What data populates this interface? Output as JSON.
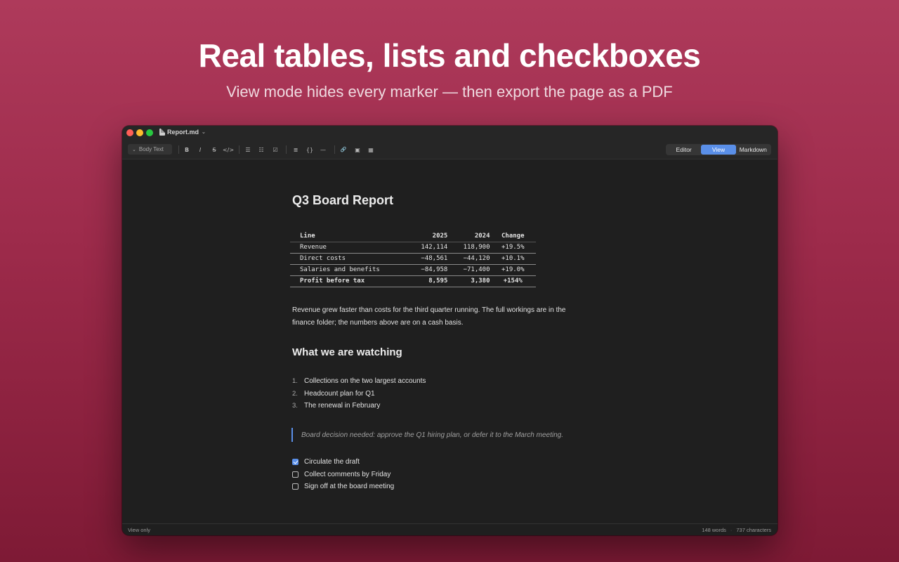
{
  "hero": {
    "headline": "Real tables, lists and checkboxes",
    "subhead": "View mode hides every marker — then export the page as a PDF"
  },
  "window": {
    "filename": "Report.md",
    "toolbar": {
      "style_select": "Body Text",
      "bold": "B",
      "italic": "I",
      "strike": "S",
      "code": "</>",
      "bullet_list": "☰",
      "numbered_list": "☷",
      "task_list": "☑",
      "heading": "≣",
      "code_block": "{}",
      "rule": "—",
      "link": "🔗",
      "image": "▣",
      "table": "▦"
    },
    "modes": [
      "Editor",
      "View",
      "Markdown"
    ],
    "active_mode": "View"
  },
  "document": {
    "title": "Q3 Board Report",
    "table": {
      "headers": [
        "Line",
        "2025",
        "2024",
        "Change"
      ],
      "rows": [
        [
          "Revenue",
          "142,114",
          "118,900",
          "+19.5%"
        ],
        [
          "Direct costs",
          "−48,561",
          "−44,120",
          "+10.1%"
        ],
        [
          "Salaries and benefits",
          "−84,958",
          "−71,400",
          "+19.0%"
        ],
        [
          "Profit before tax",
          "8,595",
          "3,380",
          "+154%"
        ]
      ]
    },
    "paragraph": "Revenue grew faster than costs for the third quarter running. The full workings are in the finance folder; the numbers above are on a cash basis.",
    "section_heading": "What we are watching",
    "ordered_list": [
      {
        "num": "1.",
        "text": "Collections on the two largest accounts"
      },
      {
        "num": "2.",
        "text": "Headcount plan for Q1"
      },
      {
        "num": "3.",
        "text": "The renewal in February"
      }
    ],
    "blockquote": "Board decision needed: approve the Q1 hiring plan, or defer it to the March meeting.",
    "tasks": [
      {
        "text": "Circulate the draft",
        "checked": true
      },
      {
        "text": "Collect comments by Friday",
        "checked": false
      },
      {
        "text": "Sign off at the board meeting",
        "checked": false
      }
    ]
  },
  "status": {
    "left": "View only",
    "words": "148 words",
    "separator": "·",
    "characters": "737 characters"
  },
  "colors": {
    "accent": "#5a8fe8",
    "background_top": "#ae3a5b",
    "background_bottom": "#7e1a35",
    "window_bg": "#1f1f1f"
  }
}
